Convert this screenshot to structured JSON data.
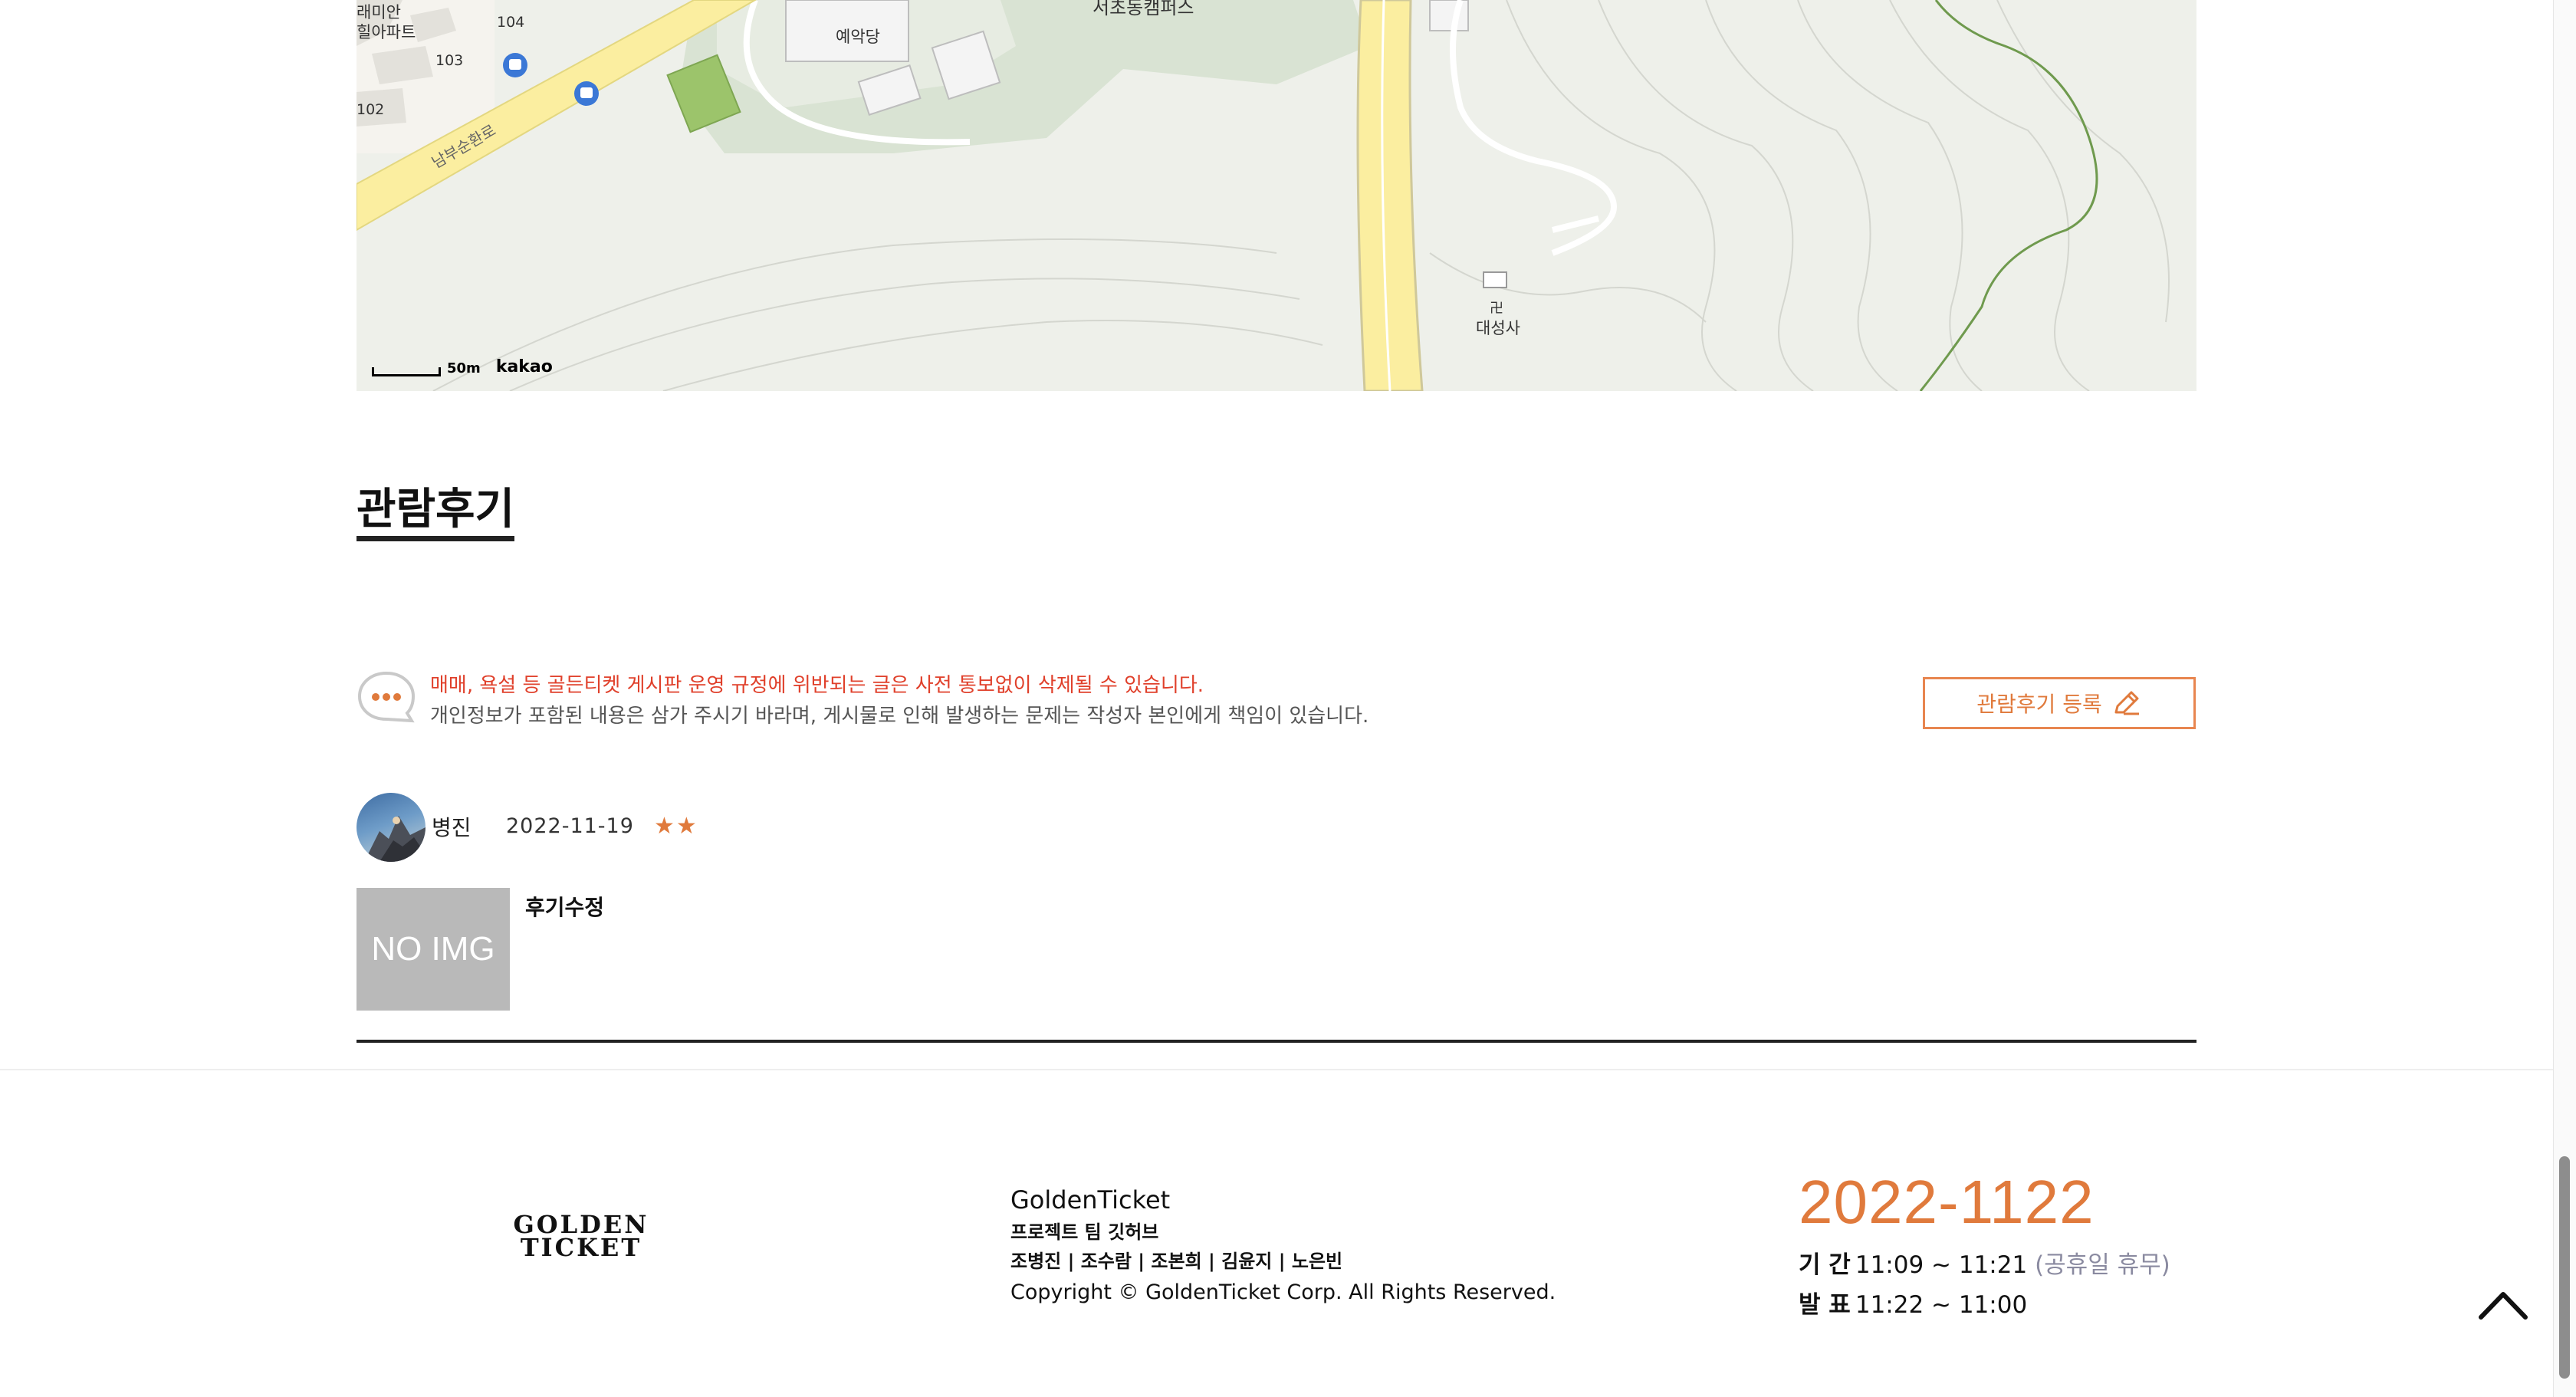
{
  "map": {
    "labels": {
      "apartment_a": "래미안",
      "apartment_b": "힐아파트",
      "block_104": "104",
      "block_103": "103",
      "block_102": "102",
      "building": "예악당",
      "campus": "서초동캠퍼스",
      "road": "남부순환로",
      "temple_symbol": "卍",
      "temple": "대성사"
    },
    "scale": "50m",
    "brand": "kakao"
  },
  "review_section": {
    "title": "관람후기",
    "notice_red": "매매, 욕설 등 골든티켓 게시판 운영 규정에 위반되는 글은 사전 통보없이 삭제될 수 있습니다.",
    "notice_gray": "개인정보가 포함된 내용은 삼가 주시기 바라며, 게시물로 인해 발생하는 문제는 작성자 본인에게 책임이 있습니다.",
    "register_button": "관람후기 등록",
    "reviews": [
      {
        "name": "병진",
        "date": "2022-11-19",
        "rating": 2,
        "stars": "★★",
        "thumb_text": "NO IMG",
        "text": "후기수정"
      }
    ]
  },
  "footer": {
    "logo_line1": "GOLDEN",
    "logo_line2": "TICKET",
    "brand": "GoldenTicket",
    "team": "프로젝트 팀 깃허브",
    "members": "조병진 | 조수람 | 조본희 | 김윤지 | 노은빈",
    "copyright": "Copyright © GoldenTicket Corp. All Rights Reserved.",
    "date_title": "2022-1122",
    "period_label": "기 간",
    "period_value": "11:09 ~ 11:21",
    "period_note": "(공휴일 휴무)",
    "announce_label": "발 표",
    "announce_value": "11:22 ~ 11:00"
  },
  "colors": {
    "accent": "#e07a3c",
    "warning": "#e0402b",
    "map_bg": "#eef0ea",
    "road": "#fbeea0"
  }
}
